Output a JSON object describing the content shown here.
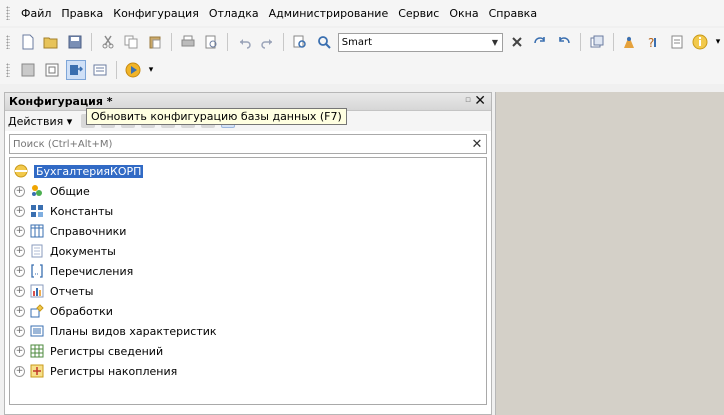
{
  "menu": {
    "items": [
      {
        "label": "Файл"
      },
      {
        "label": "Правка"
      },
      {
        "label": "Конфигурация"
      },
      {
        "label": "Отладка"
      },
      {
        "label": "Администрирование"
      },
      {
        "label": "Сервис"
      },
      {
        "label": "Окна"
      },
      {
        "label": "Справка"
      }
    ]
  },
  "toolbar": {
    "search_combo_value": "Smart"
  },
  "panel": {
    "title": "Конфигурация *",
    "actions_label": "Действия ▾",
    "tooltip": "Обновить конфигурацию базы данных (F7)",
    "search_placeholder": "Поиск (Ctrl+Alt+M)"
  },
  "tree": {
    "root": "БухгалтерияКОРП",
    "items": [
      {
        "label": "Общие",
        "icon": "common-icon"
      },
      {
        "label": "Константы",
        "icon": "constants-icon"
      },
      {
        "label": "Справочники",
        "icon": "catalogs-icon"
      },
      {
        "label": "Документы",
        "icon": "documents-icon"
      },
      {
        "label": "Перечисления",
        "icon": "enums-icon"
      },
      {
        "label": "Отчеты",
        "icon": "reports-icon"
      },
      {
        "label": "Обработки",
        "icon": "processing-icon"
      },
      {
        "label": "Планы видов характеристик",
        "icon": "chart-types-icon"
      },
      {
        "label": "Регистры сведений",
        "icon": "info-registers-icon"
      },
      {
        "label": "Регистры накопления",
        "icon": "accum-registers-icon"
      }
    ]
  },
  "colors": {
    "selection": "#316ac5",
    "workspace": "#d4d0c8",
    "tooltip_bg": "#ffffe1"
  }
}
